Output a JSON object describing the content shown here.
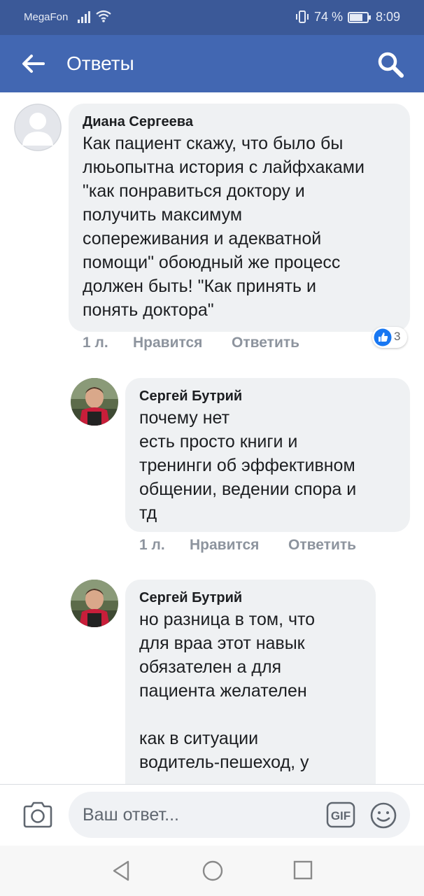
{
  "status_bar": {
    "carrier": "MegaFon",
    "battery": "74 %",
    "time": "8:09"
  },
  "app_bar": {
    "title": "Ответы",
    "back_icon": "arrow-left-icon",
    "search_icon": "search-icon"
  },
  "comments": [
    {
      "author": "Диана Сергеева",
      "text": "Как пациент скажу, что было бы\nлюьопытна история с лайфхаками\n\"как понравиться доктору и\nполучить максимум\nсопереживания и адекватной\nпомощи\" обоюдный же процесс\nдолжен быть! \"Как принять и\nпонять доктора\"",
      "time": "1 л.",
      "like_label": "Нравится",
      "reply_label": "Ответить",
      "reaction_count": "3",
      "avatar": "default-avatar"
    },
    {
      "author": "Сергей Бутрий",
      "text": "почему нет\nесть просто книги и\nтренинги об эффективном\nобщении, ведении спора и\nтд",
      "time": "1 л.",
      "like_label": "Нравится",
      "reply_label": "Ответить",
      "avatar": "user-photo"
    },
    {
      "author": "Сергей Бутрий",
      "text": "но разница в том, что\nдля враа этот навык\nобязателен а для\nпациента желателен\n\nкак в ситуации\nводитель-пешеход, у",
      "avatar": "user-photo"
    }
  ],
  "reply_bar": {
    "placeholder": "Ваш ответ...",
    "camera_icon": "camera-icon",
    "gif_label": "GIF",
    "emoji_icon": "emoji-icon"
  },
  "colors": {
    "status_bar": "#3b5998",
    "app_bar": "#4267b2",
    "bubble": "#eff1f3",
    "meta_text": "#8d949e",
    "like_blue": "#1877f2"
  }
}
